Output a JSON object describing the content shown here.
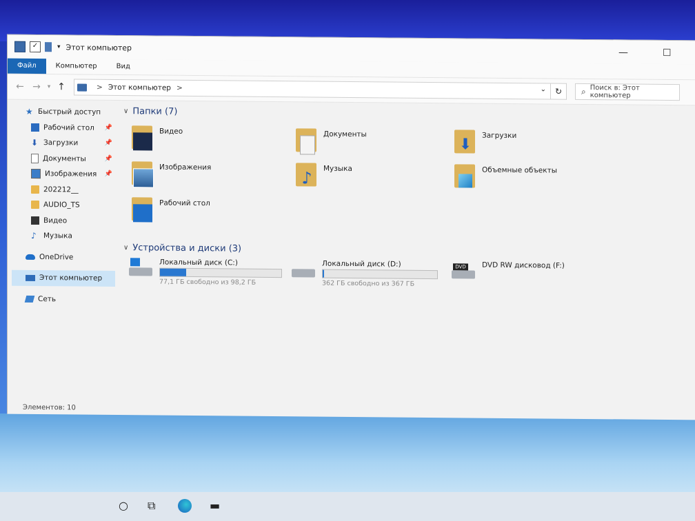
{
  "window": {
    "title": "Этот компьютер",
    "controls": {
      "minimize": "—",
      "maximize": "☐"
    }
  },
  "ribbon": {
    "tabs": [
      {
        "label": "Файл"
      },
      {
        "label": "Компьютер"
      },
      {
        "label": "Вид"
      }
    ]
  },
  "address": {
    "path_label": "Этот компьютер",
    "separator": ">",
    "search_placeholder": "Поиск в: Этот компьютер"
  },
  "sidebar": {
    "quick_access": "Быстрый доступ",
    "items": [
      {
        "label": "Рабочий стол",
        "pinned": true
      },
      {
        "label": "Загрузки",
        "pinned": true
      },
      {
        "label": "Документы",
        "pinned": true
      },
      {
        "label": "Изображения",
        "pinned": true
      },
      {
        "label": "202212__",
        "pinned": false
      },
      {
        "label": "AUDIO_TS",
        "pinned": false
      },
      {
        "label": "Видео",
        "pinned": false
      },
      {
        "label": "Музыка",
        "pinned": false
      }
    ],
    "onedrive": "OneDrive",
    "this_pc": "Этот компьютер",
    "network": "Сеть"
  },
  "folders": {
    "header": "Папки (7)",
    "items": [
      {
        "label": "Видео",
        "icon": "video-folder-icon"
      },
      {
        "label": "Документы",
        "icon": "documents-folder-icon"
      },
      {
        "label": "Загрузки",
        "icon": "downloads-folder-icon"
      },
      {
        "label": "Изображения",
        "icon": "pictures-folder-icon"
      },
      {
        "label": "Музыка",
        "icon": "music-folder-icon"
      },
      {
        "label": "Объемные объекты",
        "icon": "3d-objects-folder-icon"
      },
      {
        "label": "Рабочий стол",
        "icon": "desktop-folder-icon"
      }
    ]
  },
  "drives": {
    "header": "Устройства и диски (3)",
    "items": [
      {
        "label": "Локальный диск (C:)",
        "free": "77,1 ГБ свободно из 98,2 ГБ",
        "used_fraction": 0.215
      },
      {
        "label": "Локальный диск (D:)",
        "free": "362 ГБ свободно из 367 ГБ",
        "used_fraction": 0.014
      },
      {
        "label": "DVD RW дисковод (F:)",
        "dvd_label": "DVD"
      }
    ]
  },
  "status": {
    "items": "Элементов: 10"
  },
  "colors": {
    "accent": "#1a67b5",
    "selection": "#cce4f7",
    "drive_fill": "#2a78d0"
  }
}
